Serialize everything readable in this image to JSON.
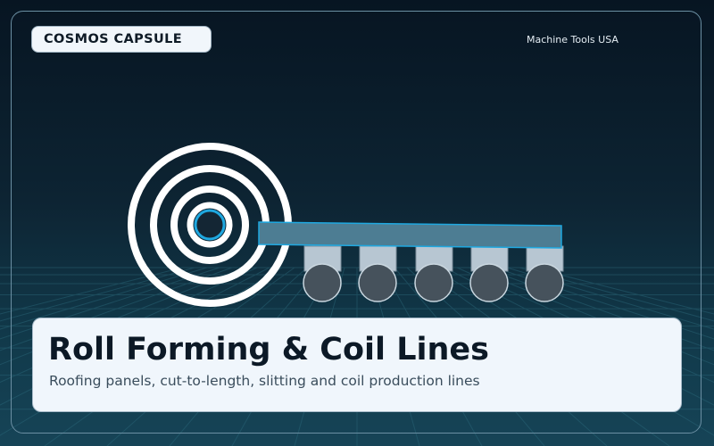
{
  "header": {
    "badge_label": "COSMOS CAPSULE",
    "brand": "Machine Tools USA"
  },
  "card": {
    "title": "Roll Forming & Coil Lines",
    "subtitle": "Roofing panels, cut-to-length, slitting and coil production lines"
  },
  "illustration": {
    "coil_rings": 4,
    "roller_count": 5,
    "colors": {
      "accent": "#1fa8e0",
      "coil": "#ffffff",
      "strip": "#4d7d93",
      "roller": "#46525c",
      "roller_block": "#b7c6d2"
    }
  }
}
